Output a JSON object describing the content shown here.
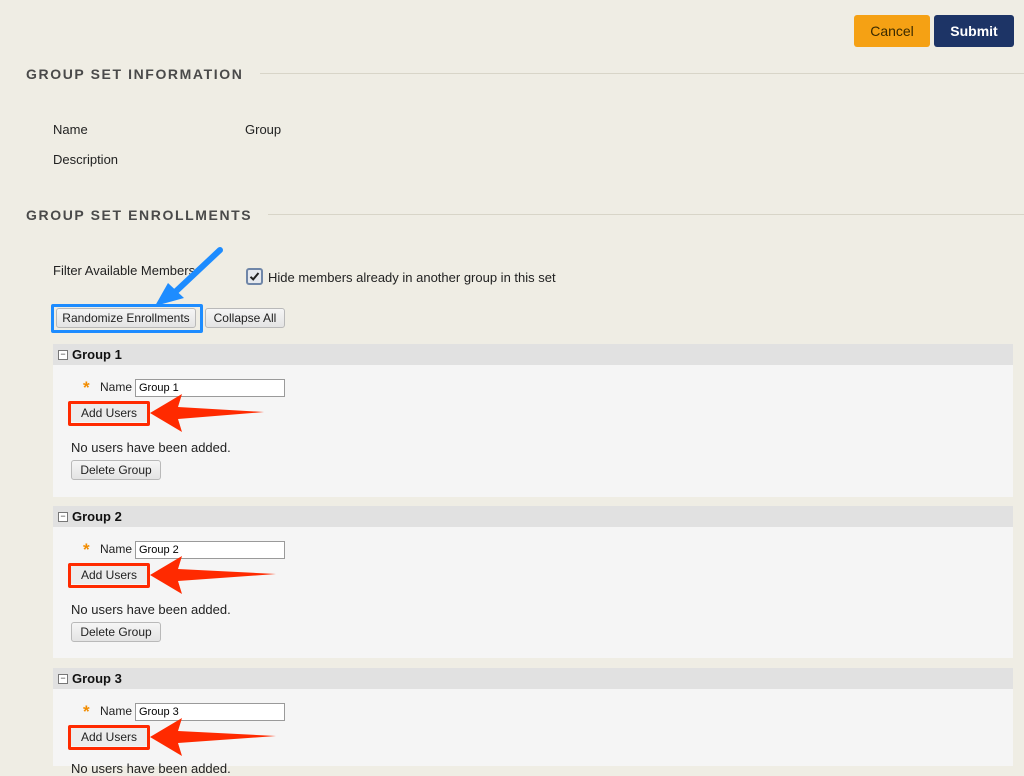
{
  "toolbar": {
    "cancel_label": "Cancel",
    "submit_label": "Submit"
  },
  "info": {
    "title": "GROUP SET INFORMATION",
    "name_label": "Name",
    "name_value": "Group",
    "description_label": "Description"
  },
  "enrollments": {
    "title": "GROUP SET ENROLLMENTS",
    "filter_label": "Filter Available Members",
    "hide_members_label": "Hide members already in another group in this set",
    "hide_members_checked": true,
    "randomize_label": "Randomize Enrollments",
    "collapse_label": "Collapse All"
  },
  "groups": [
    {
      "title": "Group 1",
      "name_label": "Name",
      "name_value": "Group 1",
      "add_users_label": "Add Users",
      "status": "No users have been added.",
      "delete_label": "Delete Group"
    },
    {
      "title": "Group 2",
      "name_label": "Name",
      "name_value": "Group 2",
      "add_users_label": "Add Users",
      "status": "No users have been added.",
      "delete_label": "Delete Group"
    },
    {
      "title": "Group 3",
      "name_label": "Name",
      "name_value": "Group 3",
      "add_users_label": "Add Users",
      "status": "No users have been added."
    }
  ],
  "colors": {
    "page_bg": "#efede4",
    "cancel": "#f5a114",
    "submit": "#1d3466",
    "highlight_red": "#ff2a00",
    "highlight_blue": "#1d8cff",
    "required_star": "#f28c00"
  }
}
